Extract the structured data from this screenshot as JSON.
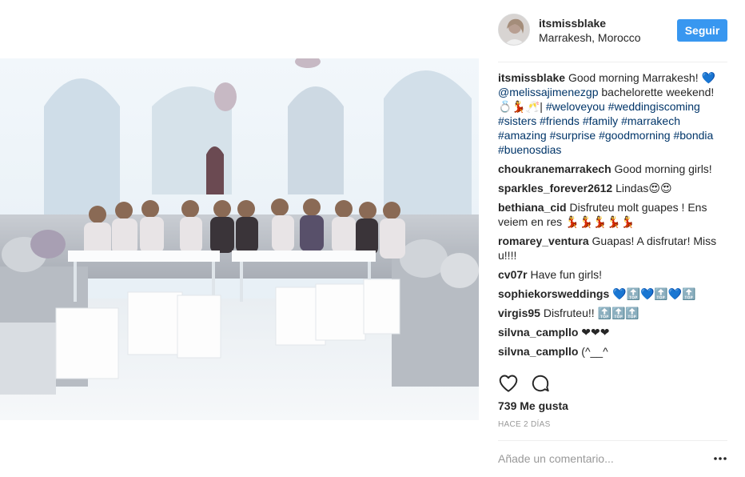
{
  "post": {
    "username": "itsmissblake",
    "location": "Marrakesh, Morocco",
    "follow_label": "Seguir"
  },
  "caption": {
    "username": "itsmissblake",
    "text_start": "Good morning Marrakesh! 💙",
    "mention": "@melissajimenezgp",
    "text_mid": "bachelorette weekend!",
    "emoji": "💍💃🥂|",
    "hashtags": [
      "#weloveyou",
      "#weddingiscoming",
      "#sisters",
      "#friends",
      "#family",
      "#marrakech",
      "#amazing",
      "#surprise",
      "#goodmorning",
      "#bondia",
      "#buenosdias"
    ]
  },
  "comments": [
    {
      "user": "choukranemarrakech",
      "text": "Good morning girls!"
    },
    {
      "user": "sparkles_forever2612",
      "text": "Lindas😍😍"
    },
    {
      "user": "bethiana_cid",
      "text": "Disfruteu molt guapes ! Ens veiem en res 💃💃💃💃💃"
    },
    {
      "user": "romarey_ventura",
      "text": "Guapas! A disfrutar! Miss u!!!!"
    },
    {
      "user": "cv07r",
      "text": "Have fun girls!"
    },
    {
      "user": "sophiekorsweddings",
      "text": "💙🔝💙🔝💙🔝"
    },
    {
      "user": "virgis95",
      "text": "Disfruteu!! 🔝🔝🔝"
    },
    {
      "user": "silvna_campllo",
      "text": "❤❤❤"
    },
    {
      "user": "silvna_campllo",
      "text": "(^__^"
    }
  ],
  "actions": {
    "like_icon": "heart-outline-icon",
    "comment_icon": "comment-bubble-icon"
  },
  "likes_text": "739 Me gusta",
  "time_text": "HACE 2 DÍAS",
  "add_comment": {
    "placeholder": "Añade un comentario..."
  },
  "colors": {
    "follow_button": "#3897f0",
    "hashtag": "#003569",
    "muted": "#999999"
  }
}
